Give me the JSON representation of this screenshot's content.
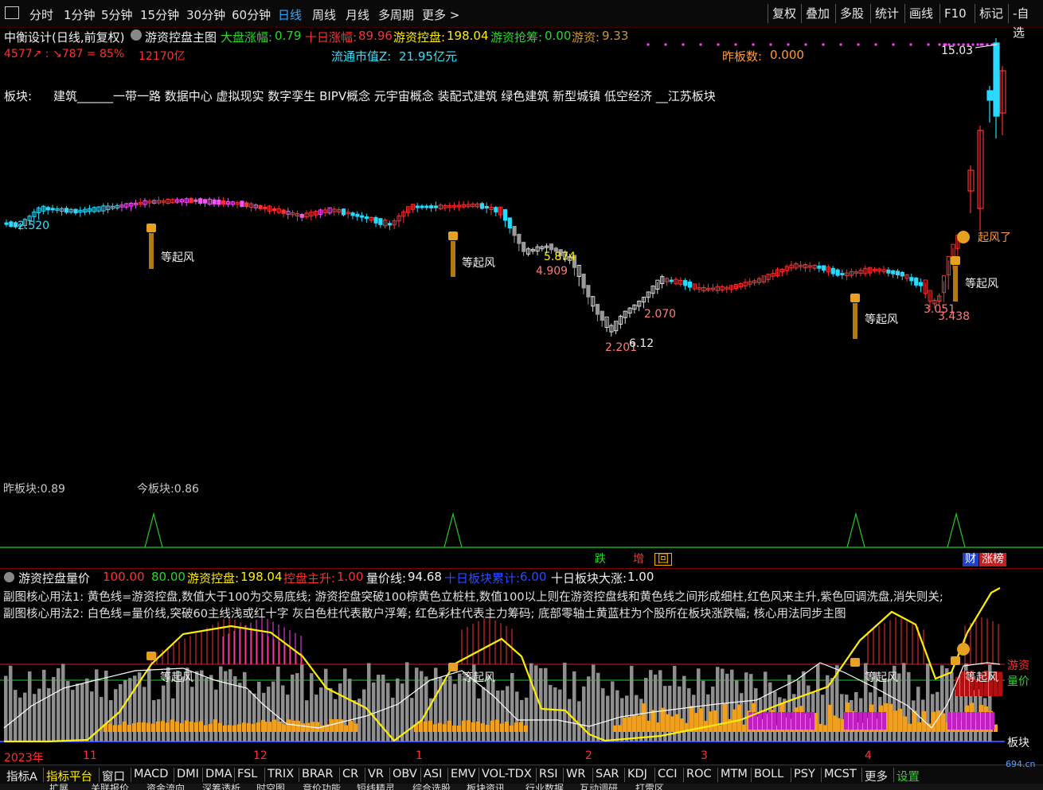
{
  "toolbar": {
    "periods": [
      "分时",
      "1分钟",
      "5分钟",
      "15分钟",
      "30分钟",
      "60分钟",
      "日线",
      "周线",
      "月线",
      "多周期",
      "更多 >"
    ],
    "active_period": "日线",
    "right_buttons": [
      "复权",
      "叠加",
      "多股",
      "统计",
      "画线",
      "F10",
      "标记",
      "-自选"
    ]
  },
  "main": {
    "stock_title": "中衡设计(日线,前复权)",
    "chart_name": "游资控盘主图",
    "market_change_label": "大盘涨幅:",
    "market_change_value": "0.79",
    "ten_day_label": "十日涨幅:",
    "ten_day_value": "89.96",
    "control_label": "游资控盘:",
    "control_value": "198.04",
    "grab_label": "游资抢筹:",
    "grab_value": "0.00",
    "hot_money_label": "游资:",
    "hot_money_value": "9.33",
    "breadth_text": "4577↗ : ↘787 = 85%",
    "volume_text": "12170亿",
    "float_cap_label": "流通市值Z:",
    "float_cap_value": "21.95亿元",
    "prev_limit_label": "昨板数:",
    "prev_limit_value": "0.000",
    "sector_label": "板块:",
    "sectors": "建筑______一带一路 数据中心 虚拟现实 数字孪生 BIPV概念 元宇宙概念 装配式建筑 绿色建筑 新型城镇 低空经济 __江苏板块",
    "price_labels": [
      "2.520",
      "5.874",
      "4.909",
      "2.201",
      "6.12",
      "2.070",
      "3.051",
      "3.438",
      "15.03"
    ],
    "wait_label": "等起风",
    "rise_label": "起风了",
    "prev_board_label": "昨板块:0.89",
    "today_board_label": "今板块:0.86",
    "event_tags": [
      "跌",
      "增",
      "回",
      "财",
      "涨榜"
    ]
  },
  "sub": {
    "name": "游资控盘量价",
    "v1": "100.00",
    "v2": "80.00",
    "control_label": "游资控盘:",
    "control_value": "198.04",
    "main_rise_label": "控盘主升:",
    "main_rise_value": "1.00",
    "price_line_label": "量价线:",
    "price_line_value": "94.68",
    "ten_day_sector_label": "十日板块累计:",
    "ten_day_sector_value": "6.00",
    "ten_day_board_label": "十日板块大涨:",
    "ten_day_board_value": "1.00",
    "method1": "副图核心用法1: 黄色线=游资控盘,数值大于100为交易底线;  游资控盘突破100棕黄色立桩柱,数值100以上则在游资控盘线和黄色线之间形成细柱,红色风来主升,紫色回调洗盘,消失则关;",
    "method2": "副图核心用法2: 白色线=量价线,突破60主线浅或红十字  灰白色柱代表散户浮筹;  红色彩柱代表主力筹码;   底部零轴土黄蓝柱为个股所在板块涨跌幅;   核心用法同步主图",
    "right_label1": "游资",
    "right_label2": "量价",
    "right_label3": "板块",
    "axis_labels": [
      "2023年",
      "11",
      "12",
      "1",
      "2",
      "3",
      "4"
    ]
  },
  "indicators": [
    "指标A",
    "指标平台",
    "窗口",
    "MACD",
    "DMI",
    "DMA",
    "FSL",
    "TRIX",
    "BRAR",
    "CR",
    "VR",
    "OBV",
    "ASI",
    "EMV",
    "VOL-TDX",
    "RSI",
    "WR",
    "SAR",
    "KDJ",
    "CCI",
    "ROC",
    "MTM",
    "BOLL",
    "PSY",
    "MCST",
    "更多",
    "设置"
  ],
  "bottom_tabs": [
    "扩展",
    "关联报价",
    "资金流向",
    "深筹透析",
    "时空图",
    "竞价功能",
    "短线精灵",
    "综合选股",
    "板块资讯",
    "行业数据",
    "互动调研",
    "打雷区"
  ],
  "watermark": "694.cn",
  "colors": {
    "up": "#ff3030",
    "down": "#2ad9ff",
    "control_line": "#ffee00",
    "price_line": "#ffffff",
    "accent": "#36a8ff"
  }
}
